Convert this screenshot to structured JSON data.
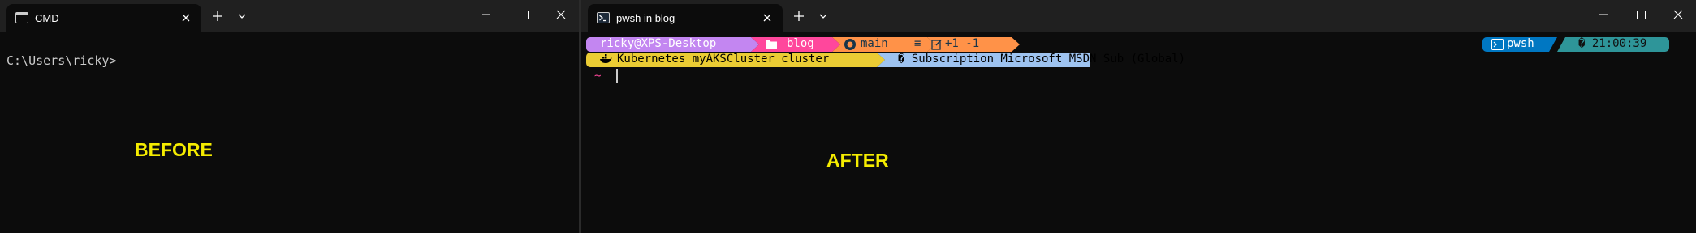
{
  "colors": {
    "terminal_bg": "#0c0c0c",
    "titlebar_bg": "#202020",
    "label_yellow": "#f5ec00",
    "seg_user": "#c386f1",
    "seg_path": "#ff479c",
    "seg_git": "#fffb38",
    "seg_git_changes": "#ff9248",
    "seg_kube": "#ebcc34",
    "seg_azure": "#9ec3f0",
    "seg_shell": "#0077c2",
    "seg_time": "#2e9599"
  },
  "left_window": {
    "tab_title": "CMD",
    "tab_icon": "console-window-icon",
    "prompt": "C:\\Users\\ricky>",
    "label": "BEFORE"
  },
  "right_window": {
    "tab_title": "pwsh in blog",
    "tab_icon": "powershell-icon",
    "label": "AFTER",
    "prompt_line1": {
      "user": "ricky@XPS-Desktop",
      "path": "blog",
      "path_icon": "folder-icon",
      "git_icon": "github-icon",
      "git_branch": "main",
      "git_status": "≡",
      "git_changes": "+1 -1",
      "git_changes_icon": "edit-icon"
    },
    "prompt_line2": {
      "kube_icon": "docker-whale-icon",
      "kube": "Kubernetes myAKSCluster cluster",
      "azure": "� Subscription Microsoft MSDN Sub (Global)"
    },
    "right_prompt": {
      "shell_icon": "terminal-icon",
      "shell": "pwsh",
      "time": "� 21:00:39"
    },
    "input_prompt": "~"
  },
  "controls": {
    "new_tab_icon": "plus-icon",
    "dropdown_icon": "chevron-down-icon",
    "minimize_icon": "minimize-icon",
    "maximize_icon": "maximize-icon",
    "close_icon": "close-icon"
  }
}
